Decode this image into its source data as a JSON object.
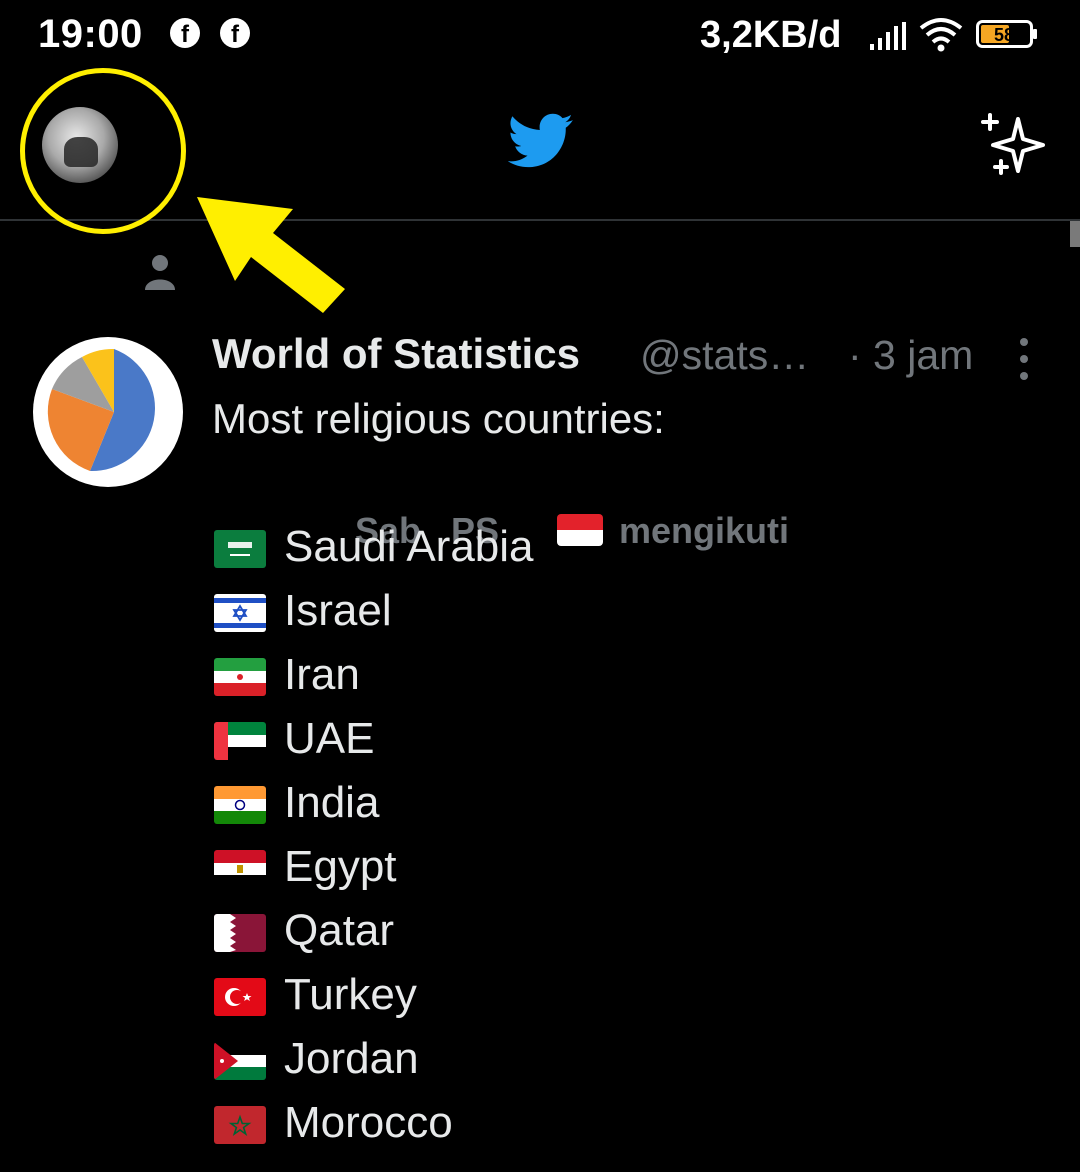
{
  "status_bar": {
    "time": "19:00",
    "notification_icons": [
      "facebook-icon",
      "facebook-icon"
    ],
    "network_speed": "3,2KB/d",
    "battery_level": "58",
    "battery_color": "#f5a623"
  },
  "header": {
    "logo": "twitter-bird-icon",
    "logo_color": "#1d9bf0",
    "right_icon": "sparkle-icon"
  },
  "annotation": {
    "highlight_color": "#ffef00",
    "target": "profile-avatar"
  },
  "tweet": {
    "social_context": {
      "icon": "person-icon",
      "name": "Sab   PS",
      "action": "mengikuti"
    },
    "author_name": "World of Statistics",
    "author_handle": "@stats…",
    "time": "· 3 jam",
    "text": "Most religious countries:",
    "countries": [
      {
        "name": "Saudi Arabia",
        "flag": "flag-saudi-arabia"
      },
      {
        "name": "Israel",
        "flag": "flag-israel"
      },
      {
        "name": "Iran",
        "flag": "flag-iran"
      },
      {
        "name": "UAE",
        "flag": "flag-uae"
      },
      {
        "name": "India",
        "flag": "flag-india"
      },
      {
        "name": "Egypt",
        "flag": "flag-egypt"
      },
      {
        "name": "Qatar",
        "flag": "flag-qatar"
      },
      {
        "name": "Turkey",
        "flag": "flag-turkey"
      },
      {
        "name": "Jordan",
        "flag": "flag-jordan"
      },
      {
        "name": "Morocco",
        "flag": "flag-morocco"
      }
    ]
  }
}
